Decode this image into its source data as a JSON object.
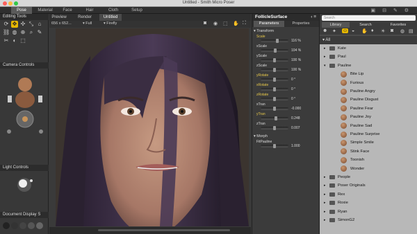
{
  "window": {
    "title": "Untitled - Smith Micro Poser"
  },
  "rooms": [
    "Pose",
    "Material",
    "Face",
    "Hair",
    "Cloth",
    "Setup"
  ],
  "left": {
    "editing_tools": "Editing Tools",
    "camera_controls": "Camera Controls",
    "light_controls": "Light Controls",
    "document_display": "Document Display S"
  },
  "document": {
    "tabs": [
      "Preview",
      "Render",
      "Untitled"
    ],
    "size": "656 x 652...",
    "view": "Full",
    "renderer": "Firefly"
  },
  "params": {
    "object": "FollicleSurface",
    "tabs": [
      "Parameters",
      "Properties"
    ],
    "transform_label": "Transform",
    "morph_label": "Morph",
    "dials": [
      {
        "label": "Scale",
        "value": "116 %",
        "pos": 0.62
      },
      {
        "label": "xScale",
        "value": "104 %",
        "pos": 0.52
      },
      {
        "label": "yScale",
        "value": "100 %",
        "pos": 0.5
      },
      {
        "label": "zScale",
        "value": "100 %",
        "pos": 0.5
      },
      {
        "label": "yRotate",
        "value": "0 °",
        "pos": 0.5
      },
      {
        "label": "xRotate",
        "value": "0 °",
        "pos": 0.5
      },
      {
        "label": "zRotate",
        "value": "0 °",
        "pos": 0.5
      },
      {
        "label": "xTran",
        "value": "-0.000",
        "pos": 0.5
      },
      {
        "label": "yTran",
        "value": "0.248",
        "pos": 0.55
      },
      {
        "label": "zTran",
        "value": "0.007",
        "pos": 0.5
      }
    ],
    "morph_dial": {
      "label": "FitPauline",
      "value": "1.000",
      "pos": 0.5
    }
  },
  "library": {
    "search_placeholder": "Search",
    "tabs": [
      "Library",
      "Search",
      "Favorites"
    ],
    "all_label": "All",
    "items": [
      {
        "label": "Kate",
        "kind": "folder",
        "indent": 1
      },
      {
        "label": "Paul",
        "kind": "folder",
        "indent": 1
      },
      {
        "label": "Pauline",
        "kind": "folder-open",
        "indent": 1
      },
      {
        "label": "Bite Lip",
        "kind": "pose",
        "indent": 2
      },
      {
        "label": "Furious",
        "kind": "pose",
        "indent": 2
      },
      {
        "label": "Pauline Angry",
        "kind": "pose",
        "indent": 2
      },
      {
        "label": "Pauline Disgust",
        "kind": "pose",
        "indent": 2
      },
      {
        "label": "Pauline Fear",
        "kind": "pose",
        "indent": 2
      },
      {
        "label": "Pauline Joy",
        "kind": "pose",
        "indent": 2
      },
      {
        "label": "Pauline Sad",
        "kind": "pose",
        "indent": 2
      },
      {
        "label": "Pauline Surprise",
        "kind": "pose",
        "indent": 2
      },
      {
        "label": "Simple Smile",
        "kind": "pose",
        "indent": 2
      },
      {
        "label": "Stink Face",
        "kind": "pose",
        "indent": 2
      },
      {
        "label": "Toonish",
        "kind": "pose",
        "indent": 2
      },
      {
        "label": "Wonder",
        "kind": "pose",
        "indent": 2
      },
      {
        "label": "People",
        "kind": "folder",
        "indent": 1
      },
      {
        "label": "Poser Originals",
        "kind": "folder",
        "indent": 1
      },
      {
        "label": "Rex",
        "kind": "folder",
        "indent": 1
      },
      {
        "label": "Roxie",
        "kind": "folder",
        "indent": 1
      },
      {
        "label": "Ryan",
        "kind": "folder",
        "indent": 1
      },
      {
        "label": "SimonG2",
        "kind": "folder",
        "indent": 1
      }
    ]
  },
  "colors": {
    "accent": "#e7b800",
    "panel": "#383838",
    "list_bg": "#b8b8b8"
  }
}
